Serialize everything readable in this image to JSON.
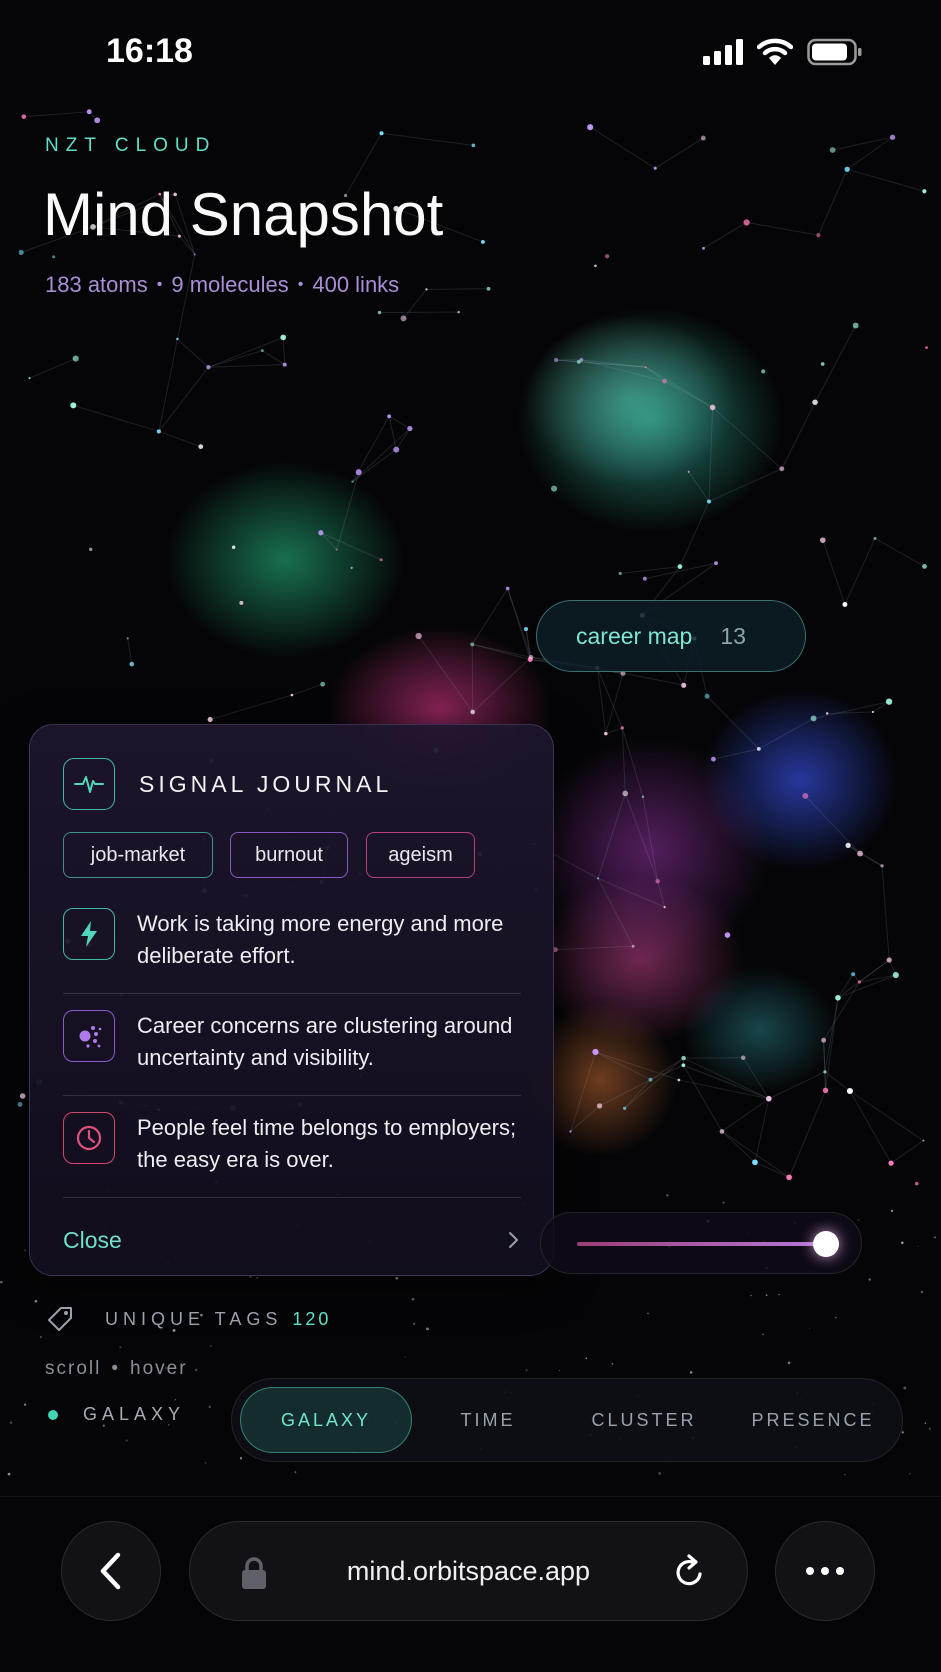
{
  "status_bar": {
    "time": "16:18"
  },
  "header": {
    "eyebrow": "NZT CLOUD",
    "title": "Mind Snapshot",
    "stats": {
      "atoms": "183 atoms",
      "molecules": "9 molecules",
      "links": "400 links"
    }
  },
  "career_pill": {
    "label": "career map",
    "count": "13"
  },
  "journal": {
    "title": "SIGNAL JOURNAL",
    "tags": [
      "job-market",
      "burnout",
      "ageism"
    ],
    "items": [
      {
        "icon": "lightning-icon",
        "text": "Work is taking more energy and more deliberate effort."
      },
      {
        "icon": "cluster-icon",
        "text": "Career concerns are clustering around uncertainty and visibility."
      },
      {
        "icon": "clock-icon",
        "text": "People feel time belongs to employers; the easy era is over."
      }
    ],
    "close_label": "Close"
  },
  "slider": {
    "value": 0.95
  },
  "unique_tags": {
    "label": "UNIQUE TAGS",
    "count": "120"
  },
  "hint": {
    "scroll": "scroll",
    "hover": "hover"
  },
  "mode": {
    "label": "GALAXY",
    "color": "#3fd6b3"
  },
  "view_tabs": [
    {
      "label": "GALAXY",
      "active": true
    },
    {
      "label": "TIME",
      "active": false
    },
    {
      "label": "CLUSTER",
      "active": false
    },
    {
      "label": "PRESENCE",
      "active": false
    }
  ],
  "browser": {
    "url": "mind.orbitspace.app"
  },
  "colors": {
    "accent": "#5fe0c8",
    "stats": "#a98fd6",
    "background": "#050507"
  }
}
